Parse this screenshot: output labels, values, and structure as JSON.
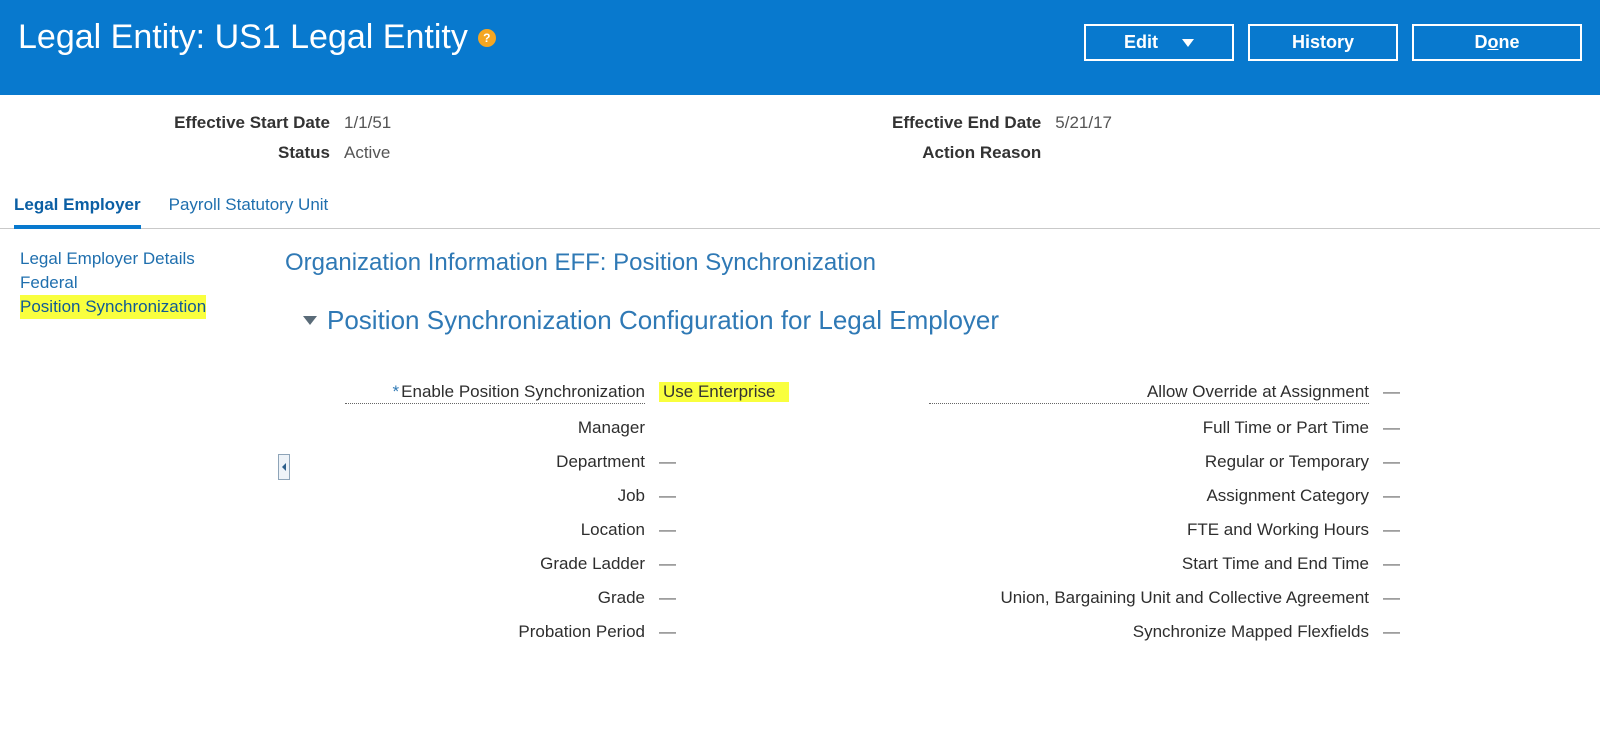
{
  "header": {
    "title": "Legal Entity: US1 Legal Entity",
    "help_glyph": "?",
    "buttons": {
      "edit": "Edit",
      "history": "History",
      "done_pre": "D",
      "done_key": "o",
      "done_post": "ne"
    }
  },
  "info": {
    "eff_start_label": "Effective Start Date",
    "eff_start_value": "1/1/51",
    "status_label": "Status",
    "status_value": "Active",
    "eff_end_label": "Effective End Date",
    "eff_end_value": "5/21/17",
    "action_reason_label": "Action Reason",
    "action_reason_value": ""
  },
  "tabs": {
    "t0": "Legal Employer",
    "t1": "Payroll Statutory Unit"
  },
  "sidenav": {
    "i0": "Legal Employer Details",
    "i1": "Federal",
    "i2": "Position Synchronization"
  },
  "main": {
    "subheading": "Organization Information EFF: Position Synchronization",
    "section_title": "Position Synchronization Configuration for Legal Employer"
  },
  "form": {
    "dash": "—",
    "left": {
      "enable_label": "Enable Position Synchronization",
      "enable_value": "Use Enterprise",
      "manager_label": "Manager",
      "department_label": "Department",
      "job_label": "Job",
      "location_label": "Location",
      "grade_ladder_label": "Grade Ladder",
      "grade_label": "Grade",
      "probation_label": "Probation Period"
    },
    "right": {
      "override_label": "Allow Override at Assignment",
      "ftpt_label": "Full Time or Part Time",
      "regtemp_label": "Regular or Temporary",
      "asgcat_label": "Assignment Category",
      "fte_label": "FTE and Working Hours",
      "startend_label": "Start Time and End Time",
      "union_label": "Union, Bargaining Unit and Collective Agreement",
      "flex_label": "Synchronize Mapped Flexfields"
    }
  }
}
